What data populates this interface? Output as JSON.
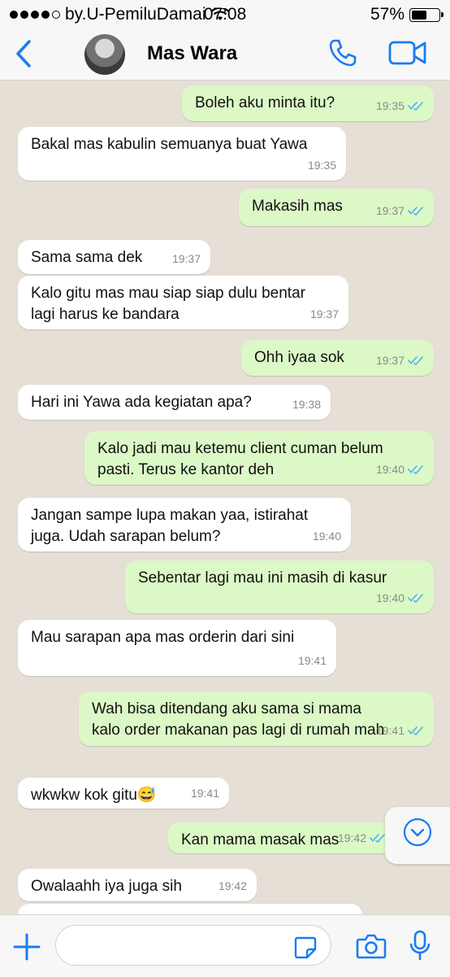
{
  "status_bar": {
    "carrier": "by.U-PemiluDamai",
    "time": "07:08",
    "battery": "57%",
    "battery_level": 0.57,
    "signal_bars": 4
  },
  "header": {
    "contact_name": "Mas Wara"
  },
  "messages": [
    {
      "dir": "out",
      "text": "Boleh aku minta itu?",
      "time": "19:35"
    },
    {
      "dir": "in",
      "text": "Bakal mas kabulin semuanya buat Yawa",
      "time": "19:35"
    },
    {
      "dir": "out",
      "text": "Makasih mas",
      "time": "19:37"
    },
    {
      "dir": "in",
      "text": "Sama sama dek",
      "time": "19:37"
    },
    {
      "dir": "in",
      "text": "Kalo gitu mas mau siap siap dulu bentar\nlagi harus ke bandara",
      "time": "19:37"
    },
    {
      "dir": "out",
      "text": "Ohh iyaa sok",
      "time": "19:37"
    },
    {
      "dir": "in",
      "text": "Hari ini Yawa ada kegiatan apa?",
      "time": "19:38"
    },
    {
      "dir": "out",
      "text": "Kalo jadi mau ketemu client cuman belum\npasti. Terus ke kantor deh",
      "time": "19:40"
    },
    {
      "dir": "in",
      "text": "Jangan sampe lupa makan yaa, istirahat\njuga. Udah sarapan belum?",
      "time": "19:40"
    },
    {
      "dir": "out",
      "text": "Sebentar lagi mau ini masih di kasur",
      "time": "19:40"
    },
    {
      "dir": "in",
      "text": "Mau sarapan apa mas orderin dari sini",
      "time": "19:41"
    },
    {
      "dir": "out",
      "text": "Wah bisa ditendang aku sama si mama\nkalo order makanan pas lagi di rumah mah",
      "time": "19:41"
    },
    {
      "dir": "in",
      "text": "wkwkw kok gitu😅",
      "time": "19:41"
    },
    {
      "dir": "out",
      "text": "Kan mama masak mas",
      "time": "19:42"
    },
    {
      "dir": "in",
      "text": "Owalaahh iya juga sih",
      "time": "19:42"
    }
  ],
  "colors": {
    "accent": "#1a7bf2",
    "outgoing_bubble": "#dcf8c6",
    "incoming_bubble": "#ffffff",
    "read_ticks": "#4fb1ef"
  },
  "icons": [
    "back-chevron-icon",
    "phone-icon",
    "video-camera-icon",
    "read-ticks-icon",
    "chevron-down-icon",
    "plus-icon",
    "sticker-icon",
    "camera-icon",
    "microphone-icon"
  ]
}
